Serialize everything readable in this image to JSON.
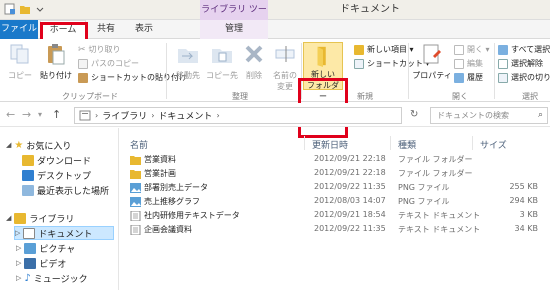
{
  "titlebar": {
    "title": "ドキュメント",
    "context_tab_label": "ライブラリ ツール"
  },
  "tabs": {
    "file": "ファイル",
    "home": "ホーム",
    "share": "共有",
    "view": "表示",
    "manage": "管理"
  },
  "ribbon": {
    "clipboard": {
      "copy": "コピー",
      "paste": "貼り付け",
      "cut": "切り取り",
      "copy_path": "パスのコピー",
      "paste_shortcut": "ショートカットの貼り付け",
      "group_label": "クリップボード"
    },
    "organize": {
      "move_to": "移動先",
      "copy_to": "コピー先",
      "delete": "削除",
      "rename_line1": "名前の",
      "rename_line2": "変更",
      "group_label": "整理"
    },
    "new": {
      "new_folder_line1": "新しい",
      "new_folder_line2": "フォルダー",
      "new_item": "新しい項目 ▾",
      "shortcut": "ショートカット ▾",
      "group_label": "新規"
    },
    "open": {
      "properties": "プロパティ",
      "open": "開く ▾",
      "edit": "編集",
      "history": "履歴",
      "group_label": "開く"
    },
    "select": {
      "select_all": "すべて選択",
      "select_none": "選択解除",
      "invert": "選択の切り",
      "group_label": "選択"
    }
  },
  "address": {
    "segments": [
      "ライブラリ",
      "ドキュメント"
    ],
    "search_placeholder": "ドキュメントの検索"
  },
  "nav": {
    "favorites": "お気に入り",
    "downloads": "ダウンロード",
    "desktop": "デスクトップ",
    "recent": "最近表示した場所",
    "libraries": "ライブラリ",
    "documents": "ドキュメント",
    "pictures": "ピクチャ",
    "videos": "ビデオ",
    "music": "ミュージック"
  },
  "columns": {
    "name": "名前",
    "date": "更新日時",
    "type": "種類",
    "size": "サイズ"
  },
  "files": [
    {
      "name": "営業資料",
      "date": "2012/09/21 22:18",
      "type": "ファイル フォルダー",
      "size": "",
      "icon": "folder-icon"
    },
    {
      "name": "営業計画",
      "date": "2012/09/21 22:18",
      "type": "ファイル フォルダー",
      "size": "",
      "icon": "folder-icon"
    },
    {
      "name": "部署別売上データ",
      "date": "2012/09/22 11:35",
      "type": "PNG ファイル",
      "size": "255 KB",
      "icon": "image-icon"
    },
    {
      "name": "売上推移グラフ",
      "date": "2012/08/03 14:07",
      "type": "PNG ファイル",
      "size": "294 KB",
      "icon": "image-icon"
    },
    {
      "name": "社内研修用テキストデータ",
      "date": "2012/09/21 18:54",
      "type": "テキスト ドキュメント",
      "size": "3 KB",
      "icon": "text-file-icon"
    },
    {
      "name": "企画会議資料",
      "date": "2012/09/22 11:35",
      "type": "テキスト ドキュメント",
      "size": "34 KB",
      "icon": "text-file-icon"
    }
  ],
  "colors": {
    "file_tab": "#1979ca",
    "highlight_box": "#e0001b",
    "folder": "#e8b830",
    "selection": "#cce8ff"
  }
}
